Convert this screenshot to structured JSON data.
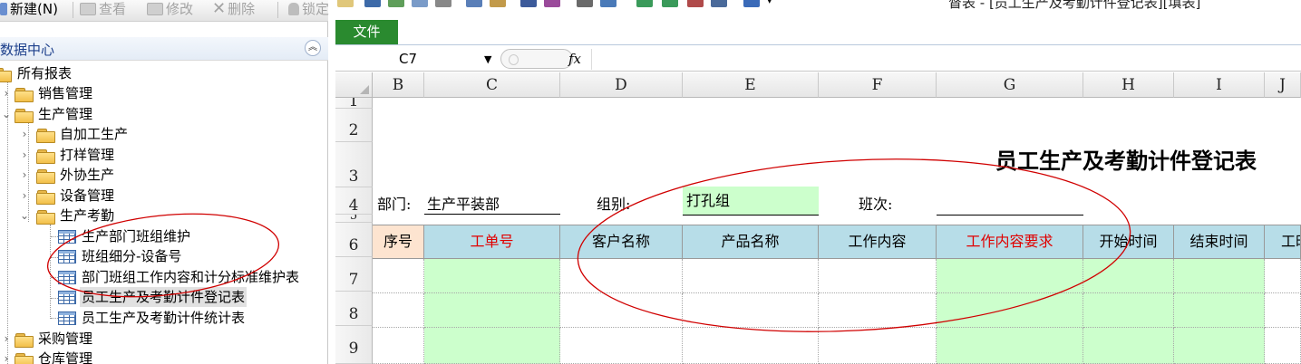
{
  "left_toolbar": {
    "new_label": "新建(N)",
    "view_label": "查看",
    "modify_label": "修改",
    "delete_label": "删除",
    "lock_label": "锁定"
  },
  "panel": {
    "title": "数据中心",
    "collapse_icon": "double-chevron-up-icon"
  },
  "tree": {
    "root": "所有报表",
    "sales": "销售管理",
    "production": "生产管理",
    "prod_children": [
      "自加工生产",
      "打样管理",
      "外协生产",
      "设备管理",
      "生产考勤"
    ],
    "attendance_children": [
      "生产部门班组维护",
      "班组细分-设备号",
      "部门班组工作内容和计分标准维护表",
      "员工生产及考勤计件登记表",
      "员工生产及考勤计件统计表"
    ],
    "purchase": "采购管理",
    "warehouse": "仓库管理"
  },
  "window": {
    "title": "督表 - [员工生产及考勤计件登记表][填表]"
  },
  "ribbon": {
    "file_tab": "文件"
  },
  "formula_bar": {
    "name_box": "C7",
    "fx": "fx",
    "formula": ""
  },
  "columns": [
    "B",
    "C",
    "D",
    "E",
    "F",
    "G",
    "H",
    "I",
    "J"
  ],
  "rows": [
    "1",
    "2",
    "3",
    "4",
    "5",
    "6",
    "7",
    "8",
    "9"
  ],
  "sheet": {
    "title": "员工生产及考勤计件登记表",
    "dept_label": "部门:",
    "dept_value": "生产平装部",
    "group_label": "组别:",
    "group_value": "打孔组",
    "shift_label": "班次:",
    "headers": [
      "序号",
      "工单号",
      "客户名称",
      "产品名称",
      "工作内容",
      "工作内容要求",
      "开始时间",
      "结束时间",
      "工时"
    ]
  },
  "colors": {
    "green_fill": "#ccffcc",
    "header_fill": "#b7dde8",
    "seq_fill": "#fde4d0",
    "red_text": "#e00000",
    "file_tab": "#2a8a2f",
    "annotation": "#d00000"
  }
}
